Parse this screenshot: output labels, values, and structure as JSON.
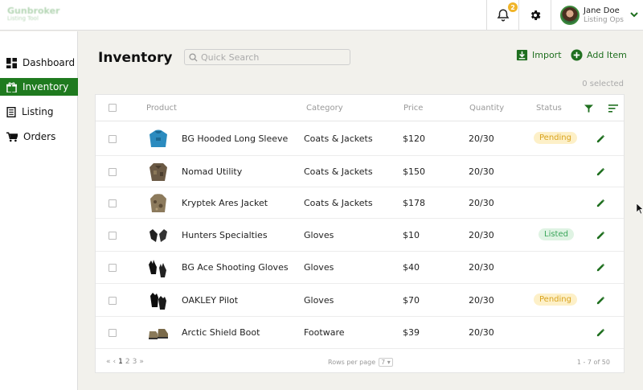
{
  "app": {
    "logo_line1": "Gunbroker",
    "logo_line2": "Listing Tool"
  },
  "header": {
    "notification_count": "2",
    "user_name": "Jane Doe",
    "user_role": "Listing Ops"
  },
  "sidebar": {
    "items": [
      {
        "label": "Dashboard"
      },
      {
        "label": "Inventory"
      },
      {
        "label": "Listing"
      },
      {
        "label": "Orders"
      }
    ]
  },
  "page": {
    "title": "Inventory",
    "search_placeholder": "Quick Search",
    "import_label": "Import",
    "add_label": "Add Item",
    "selected_text": "0 selected"
  },
  "table": {
    "columns": [
      "Product",
      "Category",
      "Price",
      "Quantity",
      "Status"
    ],
    "rows": [
      {
        "product": "BG Hooded Long Sleeve",
        "category": "Coats & Jackets",
        "price": "$120",
        "quantity": "20/30",
        "status": "Pending"
      },
      {
        "product": "Nomad Utility",
        "category": "Coats & Jackets",
        "price": "$150",
        "quantity": "20/30",
        "status": ""
      },
      {
        "product": "Kryptek Ares Jacket",
        "category": "Coats & Jackets",
        "price": "$178",
        "quantity": "20/30",
        "status": ""
      },
      {
        "product": "Hunters Specialties",
        "category": "Gloves",
        "price": "$10",
        "quantity": "20/30",
        "status": "Listed"
      },
      {
        "product": "BG Ace Shooting Gloves",
        "category": "Gloves",
        "price": "$40",
        "quantity": "20/30",
        "status": ""
      },
      {
        "product": "OAKLEY Pilot",
        "category": "Gloves",
        "price": "$70",
        "quantity": "20/30",
        "status": "Pending"
      },
      {
        "product": "Arctic Shield Boot",
        "category": "Footware",
        "price": "$39",
        "quantity": "20/30",
        "status": ""
      }
    ]
  },
  "footer": {
    "pages": [
      "1",
      "2",
      "3"
    ],
    "rows_per_page_label": "Rows per page",
    "rows_per_page_value": "7",
    "range_text": "1 - 7 of 50"
  }
}
